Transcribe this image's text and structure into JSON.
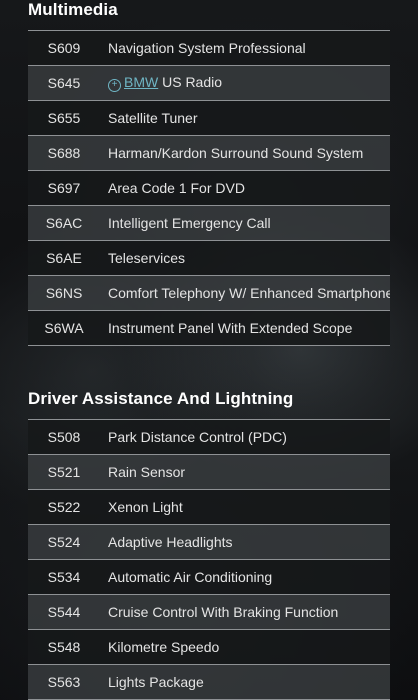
{
  "sections": [
    {
      "title": "Multimedia",
      "rows": [
        {
          "code": "S609",
          "description": "Navigation System Professional"
        },
        {
          "code": "S645",
          "brand": "BMW",
          "brand_icon": "plus-circle-icon",
          "description": "US Radio"
        },
        {
          "code": "S655",
          "description": "Satellite Tuner"
        },
        {
          "code": "S688",
          "description": "Harman/Kardon Surround Sound System"
        },
        {
          "code": "S697",
          "description": "Area Code 1 For DVD"
        },
        {
          "code": "S6AC",
          "description": "Intelligent Emergency Call"
        },
        {
          "code": "S6AE",
          "description": "Teleservices"
        },
        {
          "code": "S6NS",
          "description": "Comfort Telephony W/ Enhanced Smartphone"
        },
        {
          "code": "S6WA",
          "description": "Instrument Panel With Extended Scope"
        }
      ]
    },
    {
      "title": "Driver Assistance And Lightning",
      "rows": [
        {
          "code": "S508",
          "description": "Park Distance Control (PDC)"
        },
        {
          "code": "S521",
          "description": "Rain Sensor"
        },
        {
          "code": "S522",
          "description": "Xenon Light"
        },
        {
          "code": "S524",
          "description": "Adaptive Headlights"
        },
        {
          "code": "S534",
          "description": "Automatic Air Conditioning"
        },
        {
          "code": "S544",
          "description": "Cruise Control With Braking Function"
        },
        {
          "code": "S548",
          "description": "Kilometre Speedo"
        },
        {
          "code": "S563",
          "description": "Lights Package"
        }
      ]
    }
  ],
  "colors": {
    "link": "#6fb5c4",
    "row_dark": "#16181a",
    "row_light": "#3a3d40",
    "border": "#8e9194"
  }
}
